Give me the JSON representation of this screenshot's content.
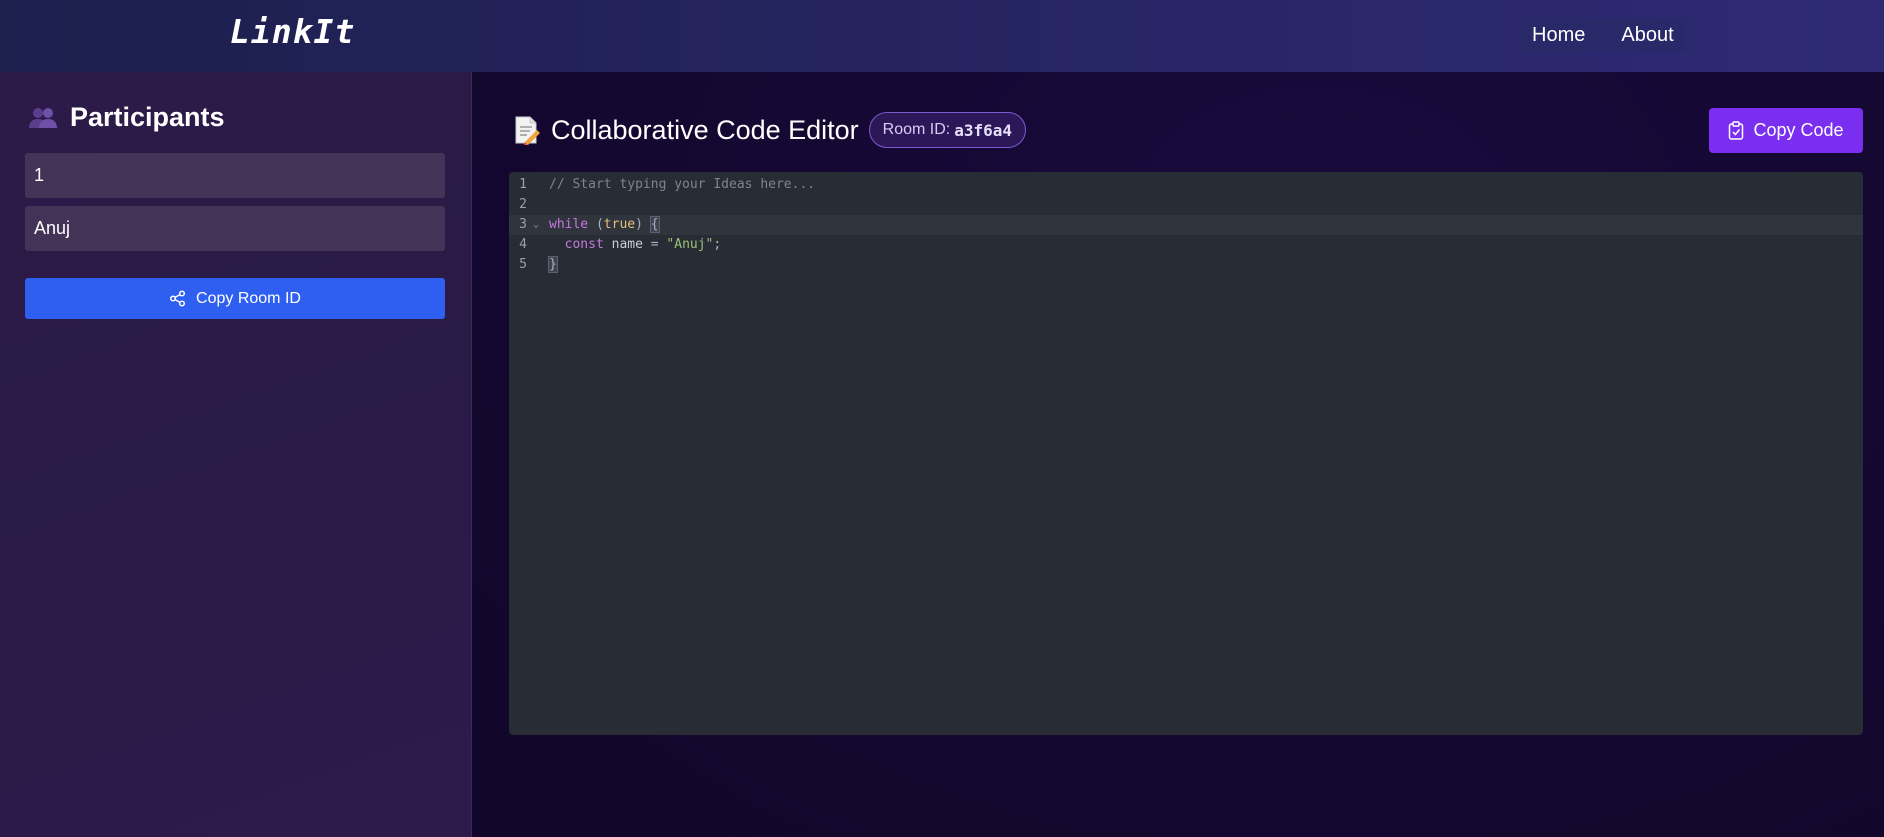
{
  "navbar": {
    "logo": "LinkIt",
    "links": [
      "Home",
      "About"
    ]
  },
  "sidebar": {
    "title": "Participants",
    "title_icon": "people-icon",
    "participants": [
      "1",
      "Anuj"
    ],
    "copy_room_button": "Copy Room ID",
    "copy_room_icon": "share-icon"
  },
  "editor": {
    "title": "Collaborative Code Editor",
    "title_icon": "document-icon",
    "room_label": "Room ID:",
    "room_id": "a3f6a4",
    "copy_code_button": "Copy Code",
    "copy_code_icon": "clipboard-icon",
    "line_numbers": [
      "1",
      "2",
      "3",
      "4",
      "5"
    ],
    "fold_marker": "⌄",
    "code": {
      "line1_comment": "// Start typing your Ideas here...",
      "line3_keyword": "while",
      "line3_open_paren": "(",
      "line3_bool": "true",
      "line3_close_paren": ") ",
      "line3_brace": "{",
      "line4_indent": "  ",
      "line4_keyword": "const",
      "line4_var": " name ",
      "line4_op": "= ",
      "line4_string": "\"Anuj\"",
      "line4_semicolon": ";",
      "line5_brace": "}"
    }
  },
  "colors": {
    "navbar": "#25245f",
    "sidebar": "#2c1a48",
    "main_bg": "#14062e",
    "participant_field": "#433457",
    "copy_room_button": "#2f5ff0",
    "copy_code_button": "#7a2ff0",
    "editor_bg": "#282c34"
  }
}
